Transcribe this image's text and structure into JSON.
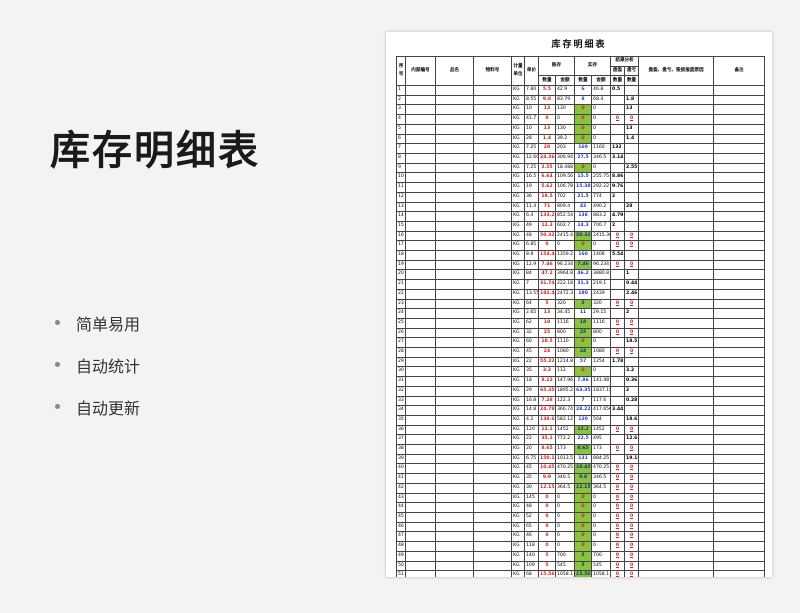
{
  "title": "库存明细表",
  "features": [
    "简单易用",
    "自动统计",
    "自动更新"
  ],
  "sheet": {
    "title": "库存明细表",
    "headers": {
      "seq": "序号",
      "internal": "内部编号",
      "name": "品名",
      "code": "物料号",
      "unit": "计量单位",
      "price": "单价",
      "book": "账存",
      "actual": "实存",
      "result": "结果分析",
      "qty": "数量",
      "amount": "金额",
      "surplus": "盘盈",
      "loss": "盘亏",
      "reason": "盘盈、盘亏、毁损报废原因",
      "remark": "备注"
    },
    "rows": [
      [
        "1",
        "KG",
        "7.80",
        "5.5",
        "42.9",
        "6",
        "46.8",
        "0.5",
        ""
      ],
      [
        "2",
        "KG",
        "8.55",
        "9.8",
        "83.79",
        "8",
        "68.4",
        "",
        "1.8"
      ],
      [
        "3",
        "KG",
        "10",
        "13",
        "130",
        "0",
        "0",
        "",
        "13"
      ],
      [
        "4",
        "KG",
        "41.7",
        "0",
        "0",
        "0",
        "0",
        "0",
        "0"
      ],
      [
        "5",
        "KG",
        "10",
        "13",
        "130",
        "0",
        "0",
        "",
        "13"
      ],
      [
        "6",
        "KG",
        "28",
        "1.4",
        "39.2",
        "0",
        "0",
        "",
        "1.4"
      ],
      [
        "7",
        "KG",
        "7.25",
        "28",
        "203",
        "160",
        "1160",
        "132",
        ""
      ],
      [
        "8",
        "KG",
        "12.60",
        "24.36",
        "306.94",
        "27.5",
        "346.5",
        "3.14",
        ""
      ],
      [
        "9",
        "KG",
        "7.25",
        "2.55",
        "18.488",
        "0",
        "0",
        "",
        "2.55"
      ],
      [
        "10",
        "KG",
        "16.5",
        "6.64",
        "109.56",
        "15.5",
        "255.75",
        "8.86",
        ""
      ],
      [
        "11",
        "KG",
        "19",
        "5.62",
        "106.78",
        "15.38",
        "292.22",
        "9.76",
        ""
      ],
      [
        "12",
        "KG",
        "36",
        "19.5",
        "702",
        "21.5",
        "774",
        "2",
        ""
      ],
      [
        "13",
        "KG",
        "11.4",
        "71",
        "809.4",
        "43",
        "490.2",
        "",
        "28"
      ],
      [
        "14",
        "KG",
        "6.4",
        "133.21",
        "852.54",
        "138",
        "883.2",
        "4.79",
        ""
      ],
      [
        "15",
        "KG",
        "49",
        "12.3",
        "602.7",
        "14.3",
        "700.7",
        "2",
        ""
      ],
      [
        "16",
        "KG",
        "48",
        "50.32",
        "2415.4",
        "50.32",
        "2415.36",
        "0",
        "0"
      ],
      [
        "17",
        "KG",
        "6.85",
        "0",
        "0",
        "0",
        "0",
        "0",
        "0"
      ],
      [
        "18",
        "KG",
        "8.8",
        "154.46",
        "1359.2",
        "160",
        "1408",
        "5.54",
        ""
      ],
      [
        "19",
        "KG",
        "12.9",
        "7.46",
        "96.234",
        "7.46",
        "96.234",
        "0",
        "0"
      ],
      [
        "20",
        "KG",
        "84",
        "47.2",
        "3964.8",
        "46.2",
        "3880.8",
        "",
        "1"
      ],
      [
        "21",
        "KG",
        "7",
        "31.74",
        "222.18",
        "31.3",
        "219.1",
        "",
        "0.44"
      ],
      [
        "22",
        "KG",
        "13.55",
        "182.46",
        "2472.3",
        "180",
        "2439",
        "",
        "2.46"
      ],
      [
        "23",
        "KG",
        "64",
        "5",
        "320",
        "5",
        "320",
        "0",
        "0"
      ],
      [
        "24",
        "KG",
        "2.65",
        "13",
        "34.45",
        "11",
        "29.15",
        "",
        "2"
      ],
      [
        "25",
        "KG",
        "62",
        "18",
        "1116",
        "18",
        "1116",
        "0",
        "0"
      ],
      [
        "26",
        "KG",
        "32",
        "25",
        "800",
        "25",
        "800",
        "0",
        "0"
      ],
      [
        "27",
        "KG",
        "60",
        "18.5",
        "1110",
        "0",
        "0",
        "",
        "18.5"
      ],
      [
        "28",
        "KG",
        "45",
        "24",
        "1080",
        "24",
        "1080",
        "0",
        "0"
      ],
      [
        "29",
        "KG",
        "22",
        "55.22",
        "1214.8",
        "57",
        "1254",
        "1.78",
        ""
      ],
      [
        "30",
        "KG",
        "35",
        "3.2",
        "112",
        "0",
        "0",
        "",
        "3.2"
      ],
      [
        "31",
        "KG",
        "18",
        "8.22",
        "147.96",
        "7.86",
        "141.48",
        "",
        "0.36"
      ],
      [
        "32",
        "KG",
        "29",
        "65.35",
        "1895.2",
        "63.35",
        "1837.15",
        "",
        "2"
      ],
      [
        "33",
        "KG",
        "16.8",
        "7.28",
        "122.3",
        "7",
        "117.6",
        "",
        "0.28"
      ],
      [
        "34",
        "KG",
        "14.8",
        "24.78",
        "366.74",
        "28.22",
        "417.656",
        "3.44",
        ""
      ],
      [
        "35",
        "KG",
        "4.2",
        "138.6",
        "582.12",
        "120",
        "504",
        "",
        "18.6"
      ],
      [
        "36",
        "KG",
        "120",
        "12.1",
        "1452",
        "12.1",
        "1452",
        "0",
        "0"
      ],
      [
        "37",
        "KG",
        "22",
        "35.1",
        "772.2",
        "22.5",
        "495",
        "",
        "12.6"
      ],
      [
        "38",
        "KG",
        "20",
        "8.65",
        "173",
        "8.65",
        "173",
        "0",
        "0"
      ],
      [
        "39",
        "KG",
        "6.75",
        "150.15",
        "1013.5",
        "131",
        "884.25",
        "",
        "19.15"
      ],
      [
        "40",
        "KG",
        "45",
        "10.45",
        "470.25",
        "10.45",
        "470.25",
        "0",
        "0"
      ],
      [
        "41",
        "KG",
        "35",
        "9.9",
        "346.5",
        "9.9",
        "346.5",
        "0",
        "0"
      ],
      [
        "42",
        "KG",
        "30",
        "12.15",
        "364.5",
        "12.15",
        "364.5",
        "0",
        "0"
      ],
      [
        "43",
        "KG",
        "145",
        "0",
        "0",
        "0",
        "0",
        "0",
        "0"
      ],
      [
        "44",
        "KG",
        "48",
        "0",
        "0",
        "0",
        "0",
        "0",
        "0"
      ],
      [
        "45",
        "KG",
        "52",
        "0",
        "0",
        "0",
        "0",
        "0",
        "0"
      ],
      [
        "46",
        "KG",
        "65",
        "0",
        "0",
        "0",
        "0",
        "0",
        "0"
      ],
      [
        "47",
        "KG",
        "46",
        "0",
        "0",
        "0",
        "0",
        "0",
        "0"
      ],
      [
        "48",
        "KG",
        "118",
        "0",
        "0",
        "0",
        "0",
        "0",
        "0"
      ],
      [
        "49",
        "KG",
        "140",
        "5",
        "700",
        "5",
        "700",
        "0",
        "0"
      ],
      [
        "50",
        "KG",
        "109",
        "5",
        "545",
        "5",
        "545",
        "0",
        "0"
      ],
      [
        "51",
        "KG",
        "68",
        "15.56",
        "1058.1",
        "15.56",
        "1058.1",
        "0",
        "0"
      ]
    ]
  },
  "colors": {
    "red": "#d21f1f",
    "blue": "#1f3fc8",
    "green": "#8ac43f"
  }
}
